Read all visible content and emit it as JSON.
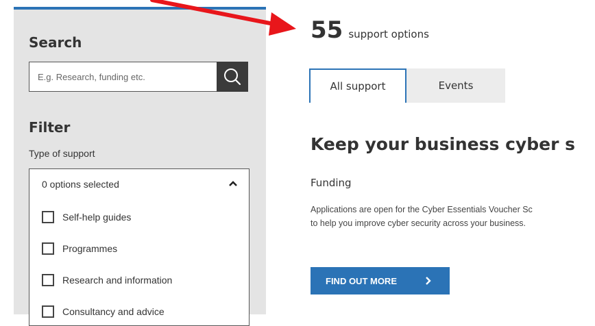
{
  "sidebar": {
    "search_heading": "Search",
    "search_placeholder": "E.g. Research, funding etc.",
    "filter_heading": "Filter",
    "type_label": "Type of support",
    "options_selected": "0 options selected",
    "options": [
      {
        "label": "Self-help guides",
        "checked": false
      },
      {
        "label": "Programmes",
        "checked": false
      },
      {
        "label": "Research and information",
        "checked": false
      },
      {
        "label": "Consultancy and advice",
        "checked": false
      }
    ]
  },
  "main": {
    "count": "55",
    "count_label": "support options",
    "tabs": [
      {
        "label": "All support",
        "active": true
      },
      {
        "label": "Events",
        "active": false
      }
    ],
    "card": {
      "title": "Keep your business cyber s",
      "tag": "Funding",
      "desc_line1": "Applications are open for the Cyber Essentials Voucher Sc",
      "desc_line2": "to help you improve cyber security across your business.",
      "cta_label": "FIND OUT MORE"
    }
  },
  "colors": {
    "accent": "#2b73b6",
    "sidebar_bg": "#e4e4e4",
    "annotation_arrow": "#e8161b",
    "search_button": "#3b3b3b"
  },
  "icons": [
    "search-icon",
    "chevron-up-icon",
    "chevron-right-icon",
    "annotation-arrow"
  ]
}
